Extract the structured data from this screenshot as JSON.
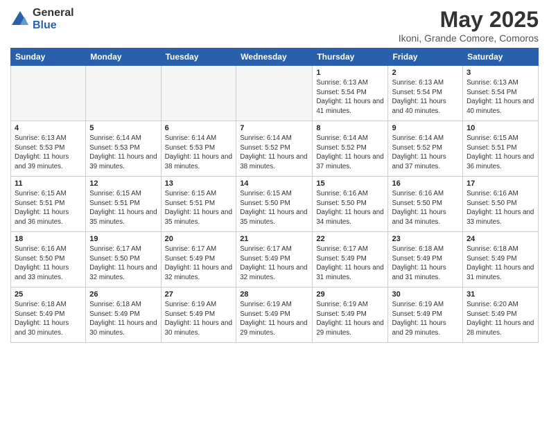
{
  "logo": {
    "general": "General",
    "blue": "Blue"
  },
  "header": {
    "month": "May 2025",
    "location": "Ikoni, Grande Comore, Comoros"
  },
  "days_of_week": [
    "Sunday",
    "Monday",
    "Tuesday",
    "Wednesday",
    "Thursday",
    "Friday",
    "Saturday"
  ],
  "weeks": [
    [
      {
        "day": "",
        "info": ""
      },
      {
        "day": "",
        "info": ""
      },
      {
        "day": "",
        "info": ""
      },
      {
        "day": "",
        "info": ""
      },
      {
        "day": "1",
        "info": "Sunrise: 6:13 AM\nSunset: 5:54 PM\nDaylight: 11 hours and 41 minutes."
      },
      {
        "day": "2",
        "info": "Sunrise: 6:13 AM\nSunset: 5:54 PM\nDaylight: 11 hours and 40 minutes."
      },
      {
        "day": "3",
        "info": "Sunrise: 6:13 AM\nSunset: 5:54 PM\nDaylight: 11 hours and 40 minutes."
      }
    ],
    [
      {
        "day": "4",
        "info": "Sunrise: 6:13 AM\nSunset: 5:53 PM\nDaylight: 11 hours and 39 minutes."
      },
      {
        "day": "5",
        "info": "Sunrise: 6:14 AM\nSunset: 5:53 PM\nDaylight: 11 hours and 39 minutes."
      },
      {
        "day": "6",
        "info": "Sunrise: 6:14 AM\nSunset: 5:53 PM\nDaylight: 11 hours and 38 minutes."
      },
      {
        "day": "7",
        "info": "Sunrise: 6:14 AM\nSunset: 5:52 PM\nDaylight: 11 hours and 38 minutes."
      },
      {
        "day": "8",
        "info": "Sunrise: 6:14 AM\nSunset: 5:52 PM\nDaylight: 11 hours and 37 minutes."
      },
      {
        "day": "9",
        "info": "Sunrise: 6:14 AM\nSunset: 5:52 PM\nDaylight: 11 hours and 37 minutes."
      },
      {
        "day": "10",
        "info": "Sunrise: 6:15 AM\nSunset: 5:51 PM\nDaylight: 11 hours and 36 minutes."
      }
    ],
    [
      {
        "day": "11",
        "info": "Sunrise: 6:15 AM\nSunset: 5:51 PM\nDaylight: 11 hours and 36 minutes."
      },
      {
        "day": "12",
        "info": "Sunrise: 6:15 AM\nSunset: 5:51 PM\nDaylight: 11 hours and 35 minutes."
      },
      {
        "day": "13",
        "info": "Sunrise: 6:15 AM\nSunset: 5:51 PM\nDaylight: 11 hours and 35 minutes."
      },
      {
        "day": "14",
        "info": "Sunrise: 6:15 AM\nSunset: 5:50 PM\nDaylight: 11 hours and 35 minutes."
      },
      {
        "day": "15",
        "info": "Sunrise: 6:16 AM\nSunset: 5:50 PM\nDaylight: 11 hours and 34 minutes."
      },
      {
        "day": "16",
        "info": "Sunrise: 6:16 AM\nSunset: 5:50 PM\nDaylight: 11 hours and 34 minutes."
      },
      {
        "day": "17",
        "info": "Sunrise: 6:16 AM\nSunset: 5:50 PM\nDaylight: 11 hours and 33 minutes."
      }
    ],
    [
      {
        "day": "18",
        "info": "Sunrise: 6:16 AM\nSunset: 5:50 PM\nDaylight: 11 hours and 33 minutes."
      },
      {
        "day": "19",
        "info": "Sunrise: 6:17 AM\nSunset: 5:50 PM\nDaylight: 11 hours and 32 minutes."
      },
      {
        "day": "20",
        "info": "Sunrise: 6:17 AM\nSunset: 5:49 PM\nDaylight: 11 hours and 32 minutes."
      },
      {
        "day": "21",
        "info": "Sunrise: 6:17 AM\nSunset: 5:49 PM\nDaylight: 11 hours and 32 minutes."
      },
      {
        "day": "22",
        "info": "Sunrise: 6:17 AM\nSunset: 5:49 PM\nDaylight: 11 hours and 31 minutes."
      },
      {
        "day": "23",
        "info": "Sunrise: 6:18 AM\nSunset: 5:49 PM\nDaylight: 11 hours and 31 minutes."
      },
      {
        "day": "24",
        "info": "Sunrise: 6:18 AM\nSunset: 5:49 PM\nDaylight: 11 hours and 31 minutes."
      }
    ],
    [
      {
        "day": "25",
        "info": "Sunrise: 6:18 AM\nSunset: 5:49 PM\nDaylight: 11 hours and 30 minutes."
      },
      {
        "day": "26",
        "info": "Sunrise: 6:18 AM\nSunset: 5:49 PM\nDaylight: 11 hours and 30 minutes."
      },
      {
        "day": "27",
        "info": "Sunrise: 6:19 AM\nSunset: 5:49 PM\nDaylight: 11 hours and 30 minutes."
      },
      {
        "day": "28",
        "info": "Sunrise: 6:19 AM\nSunset: 5:49 PM\nDaylight: 11 hours and 29 minutes."
      },
      {
        "day": "29",
        "info": "Sunrise: 6:19 AM\nSunset: 5:49 PM\nDaylight: 11 hours and 29 minutes."
      },
      {
        "day": "30",
        "info": "Sunrise: 6:19 AM\nSunset: 5:49 PM\nDaylight: 11 hours and 29 minutes."
      },
      {
        "day": "31",
        "info": "Sunrise: 6:20 AM\nSunset: 5:49 PM\nDaylight: 11 hours and 28 minutes."
      }
    ]
  ]
}
